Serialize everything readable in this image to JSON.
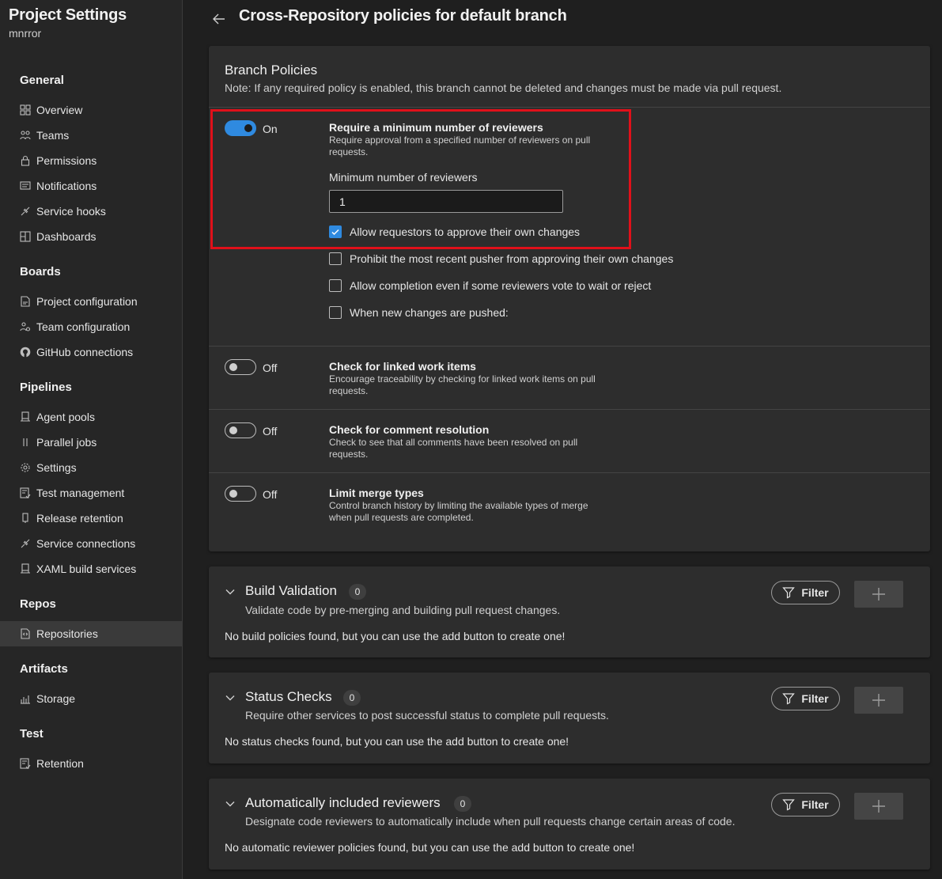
{
  "project": {
    "title": "Project Settings",
    "org": "mnrror"
  },
  "sidebar": {
    "sections": [
      {
        "heading": "General",
        "items": [
          "Overview",
          "Teams",
          "Permissions",
          "Notifications",
          "Service hooks",
          "Dashboards"
        ]
      },
      {
        "heading": "Boards",
        "items": [
          "Project configuration",
          "Team configuration",
          "GitHub connections"
        ]
      },
      {
        "heading": "Pipelines",
        "items": [
          "Agent pools",
          "Parallel jobs",
          "Settings",
          "Test management",
          "Release retention",
          "Service connections",
          "XAML build services"
        ]
      },
      {
        "heading": "Repos",
        "items": [
          "Repositories"
        ]
      },
      {
        "heading": "Artifacts",
        "items": [
          "Storage"
        ]
      },
      {
        "heading": "Test",
        "items": [
          "Retention"
        ]
      }
    ],
    "active_item": "Repositories"
  },
  "page": {
    "title": "Cross-Repository policies for default branch"
  },
  "branch_policies": {
    "title": "Branch Policies",
    "note": "Note: If any required policy is enabled, this branch cannot be deleted and changes must be made via pull request.",
    "policies": [
      {
        "state": "On",
        "title": "Require a minimum number of reviewers",
        "desc": "Require approval from a specified number of reviewers on pull requests.",
        "field_label": "Minimum number of reviewers",
        "field_value": "1",
        "options": [
          {
            "label": "Allow requestors to approve their own changes",
            "checked": true
          },
          {
            "label": "Prohibit the most recent pusher from approving their own changes",
            "checked": false
          },
          {
            "label": "Allow completion even if some reviewers vote to wait or reject",
            "checked": false
          },
          {
            "label": "When new changes are pushed:",
            "checked": false
          }
        ]
      },
      {
        "state": "Off",
        "title": "Check for linked work items",
        "desc": "Encourage traceability by checking for linked work items on pull requests."
      },
      {
        "state": "Off",
        "title": "Check for comment resolution",
        "desc": "Check to see that all comments have been resolved on pull requests."
      },
      {
        "state": "Off",
        "title": "Limit merge types",
        "desc": "Control branch history by limiting the available types of merge when pull requests are completed."
      }
    ]
  },
  "sections": [
    {
      "title": "Build Validation",
      "count": "0",
      "desc": "Validate code by pre-merging and building pull request changes.",
      "empty": "No build policies found, but you can use the add button to create one!",
      "filter_label": "Filter"
    },
    {
      "title": "Status Checks",
      "count": "0",
      "desc": "Require other services to post successful status to complete pull requests.",
      "empty": "No status checks found, but you can use the add button to create one!",
      "filter_label": "Filter"
    },
    {
      "title": "Automatically included reviewers",
      "count": "0",
      "desc": "Designate code reviewers to automatically include when pull requests change certain areas of code.",
      "empty": "No automatic reviewer policies found, but you can use the add button to create one!",
      "filter_label": "Filter"
    }
  ],
  "colors": {
    "accent": "#2f8ae0",
    "highlight": "#e0101a",
    "background": "#1f1f1f",
    "card": "#2d2d2d"
  }
}
